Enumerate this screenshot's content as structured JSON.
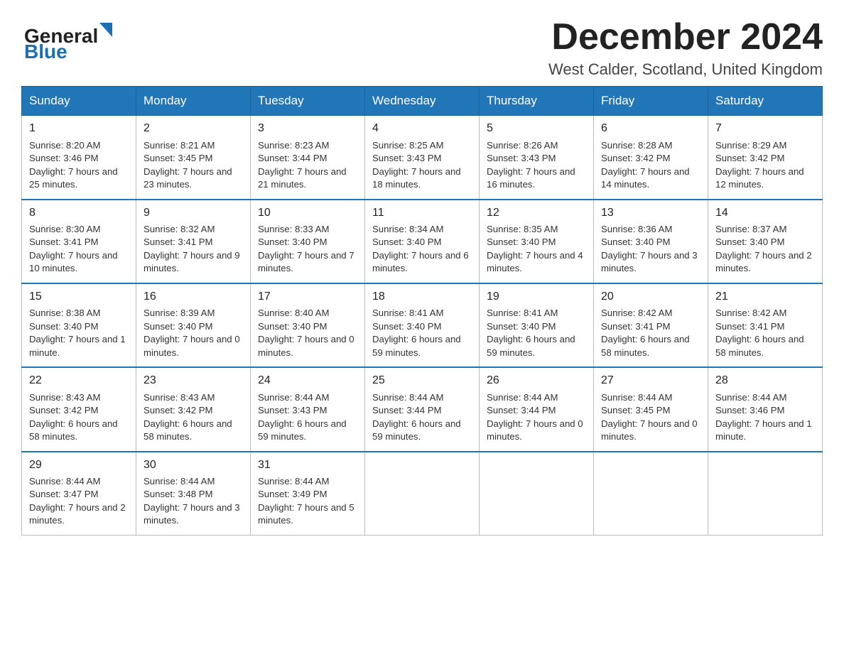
{
  "header": {
    "logo_general": "General",
    "logo_blue": "Blue",
    "month_title": "December 2024",
    "location": "West Calder, Scotland, United Kingdom"
  },
  "days_of_week": [
    "Sunday",
    "Monday",
    "Tuesday",
    "Wednesday",
    "Thursday",
    "Friday",
    "Saturday"
  ],
  "weeks": [
    [
      {
        "day": "1",
        "sunrise": "8:20 AM",
        "sunset": "3:46 PM",
        "daylight": "7 hours and 25 minutes."
      },
      {
        "day": "2",
        "sunrise": "8:21 AM",
        "sunset": "3:45 PM",
        "daylight": "7 hours and 23 minutes."
      },
      {
        "day": "3",
        "sunrise": "8:23 AM",
        "sunset": "3:44 PM",
        "daylight": "7 hours and 21 minutes."
      },
      {
        "day": "4",
        "sunrise": "8:25 AM",
        "sunset": "3:43 PM",
        "daylight": "7 hours and 18 minutes."
      },
      {
        "day": "5",
        "sunrise": "8:26 AM",
        "sunset": "3:43 PM",
        "daylight": "7 hours and 16 minutes."
      },
      {
        "day": "6",
        "sunrise": "8:28 AM",
        "sunset": "3:42 PM",
        "daylight": "7 hours and 14 minutes."
      },
      {
        "day": "7",
        "sunrise": "8:29 AM",
        "sunset": "3:42 PM",
        "daylight": "7 hours and 12 minutes."
      }
    ],
    [
      {
        "day": "8",
        "sunrise": "8:30 AM",
        "sunset": "3:41 PM",
        "daylight": "7 hours and 10 minutes."
      },
      {
        "day": "9",
        "sunrise": "8:32 AM",
        "sunset": "3:41 PM",
        "daylight": "7 hours and 9 minutes."
      },
      {
        "day": "10",
        "sunrise": "8:33 AM",
        "sunset": "3:40 PM",
        "daylight": "7 hours and 7 minutes."
      },
      {
        "day": "11",
        "sunrise": "8:34 AM",
        "sunset": "3:40 PM",
        "daylight": "7 hours and 6 minutes."
      },
      {
        "day": "12",
        "sunrise": "8:35 AM",
        "sunset": "3:40 PM",
        "daylight": "7 hours and 4 minutes."
      },
      {
        "day": "13",
        "sunrise": "8:36 AM",
        "sunset": "3:40 PM",
        "daylight": "7 hours and 3 minutes."
      },
      {
        "day": "14",
        "sunrise": "8:37 AM",
        "sunset": "3:40 PM",
        "daylight": "7 hours and 2 minutes."
      }
    ],
    [
      {
        "day": "15",
        "sunrise": "8:38 AM",
        "sunset": "3:40 PM",
        "daylight": "7 hours and 1 minute."
      },
      {
        "day": "16",
        "sunrise": "8:39 AM",
        "sunset": "3:40 PM",
        "daylight": "7 hours and 0 minutes."
      },
      {
        "day": "17",
        "sunrise": "8:40 AM",
        "sunset": "3:40 PM",
        "daylight": "7 hours and 0 minutes."
      },
      {
        "day": "18",
        "sunrise": "8:41 AM",
        "sunset": "3:40 PM",
        "daylight": "6 hours and 59 minutes."
      },
      {
        "day": "19",
        "sunrise": "8:41 AM",
        "sunset": "3:40 PM",
        "daylight": "6 hours and 59 minutes."
      },
      {
        "day": "20",
        "sunrise": "8:42 AM",
        "sunset": "3:41 PM",
        "daylight": "6 hours and 58 minutes."
      },
      {
        "day": "21",
        "sunrise": "8:42 AM",
        "sunset": "3:41 PM",
        "daylight": "6 hours and 58 minutes."
      }
    ],
    [
      {
        "day": "22",
        "sunrise": "8:43 AM",
        "sunset": "3:42 PM",
        "daylight": "6 hours and 58 minutes."
      },
      {
        "day": "23",
        "sunrise": "8:43 AM",
        "sunset": "3:42 PM",
        "daylight": "6 hours and 58 minutes."
      },
      {
        "day": "24",
        "sunrise": "8:44 AM",
        "sunset": "3:43 PM",
        "daylight": "6 hours and 59 minutes."
      },
      {
        "day": "25",
        "sunrise": "8:44 AM",
        "sunset": "3:44 PM",
        "daylight": "6 hours and 59 minutes."
      },
      {
        "day": "26",
        "sunrise": "8:44 AM",
        "sunset": "3:44 PM",
        "daylight": "7 hours and 0 minutes."
      },
      {
        "day": "27",
        "sunrise": "8:44 AM",
        "sunset": "3:45 PM",
        "daylight": "7 hours and 0 minutes."
      },
      {
        "day": "28",
        "sunrise": "8:44 AM",
        "sunset": "3:46 PM",
        "daylight": "7 hours and 1 minute."
      }
    ],
    [
      {
        "day": "29",
        "sunrise": "8:44 AM",
        "sunset": "3:47 PM",
        "daylight": "7 hours and 2 minutes."
      },
      {
        "day": "30",
        "sunrise": "8:44 AM",
        "sunset": "3:48 PM",
        "daylight": "7 hours and 3 minutes."
      },
      {
        "day": "31",
        "sunrise": "8:44 AM",
        "sunset": "3:49 PM",
        "daylight": "7 hours and 5 minutes."
      },
      null,
      null,
      null,
      null
    ]
  ]
}
